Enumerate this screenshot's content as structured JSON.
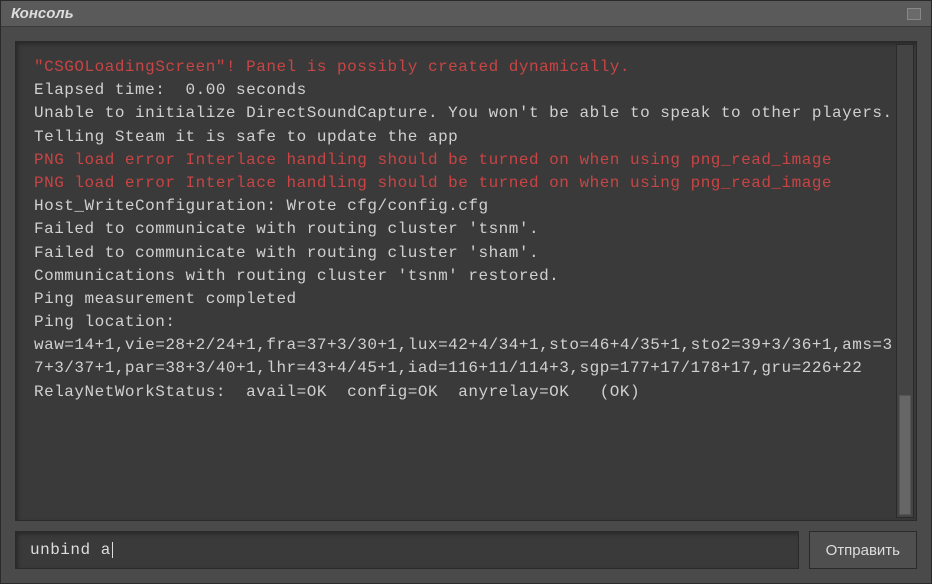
{
  "window": {
    "title": "Консоль"
  },
  "console": {
    "lines": [
      {
        "text": "\"CSGOLoadingScreen\"! Panel is possibly created dynamically.",
        "cls": "error"
      },
      {
        "text": "Elapsed time:  0.00 seconds",
        "cls": "normal"
      },
      {
        "text": "Unable to initialize DirectSoundCapture. You won't be able to speak to other players.Telling Steam it is safe to update the app",
        "cls": "normal"
      },
      {
        "text": "PNG load error Interlace handling should be turned on when using png_read_image",
        "cls": "error"
      },
      {
        "text": "PNG load error Interlace handling should be turned on when using png_read_image",
        "cls": "error"
      },
      {
        "text": "Host_WriteConfiguration: Wrote cfg/config.cfg",
        "cls": "normal"
      },
      {
        "text": "Failed to communicate with routing cluster 'tsnm'.",
        "cls": "normal"
      },
      {
        "text": "Failed to communicate with routing cluster 'sham'.",
        "cls": "normal"
      },
      {
        "text": "Communications with routing cluster 'tsnm' restored.",
        "cls": "normal"
      },
      {
        "text": "Ping measurement completed",
        "cls": "normal"
      },
      {
        "text": "Ping location:",
        "cls": "normal"
      },
      {
        "text": "waw=14+1,vie=28+2/24+1,fra=37+3/30+1,lux=42+4/34+1,sto=46+4/35+1,sto2=39+3/36+1,ams=37+3/37+1,par=38+3/40+1,lhr=43+4/45+1,iad=116+11/114+3,sgp=177+17/178+17,gru=226+22",
        "cls": "normal"
      },
      {
        "text": "RelayNetWorkStatus:  avail=OK  config=OK  anyrelay=OK   (OK)",
        "cls": "normal"
      }
    ]
  },
  "input": {
    "value": "unbind a",
    "placeholder": ""
  },
  "buttons": {
    "submit": "Отправить"
  }
}
